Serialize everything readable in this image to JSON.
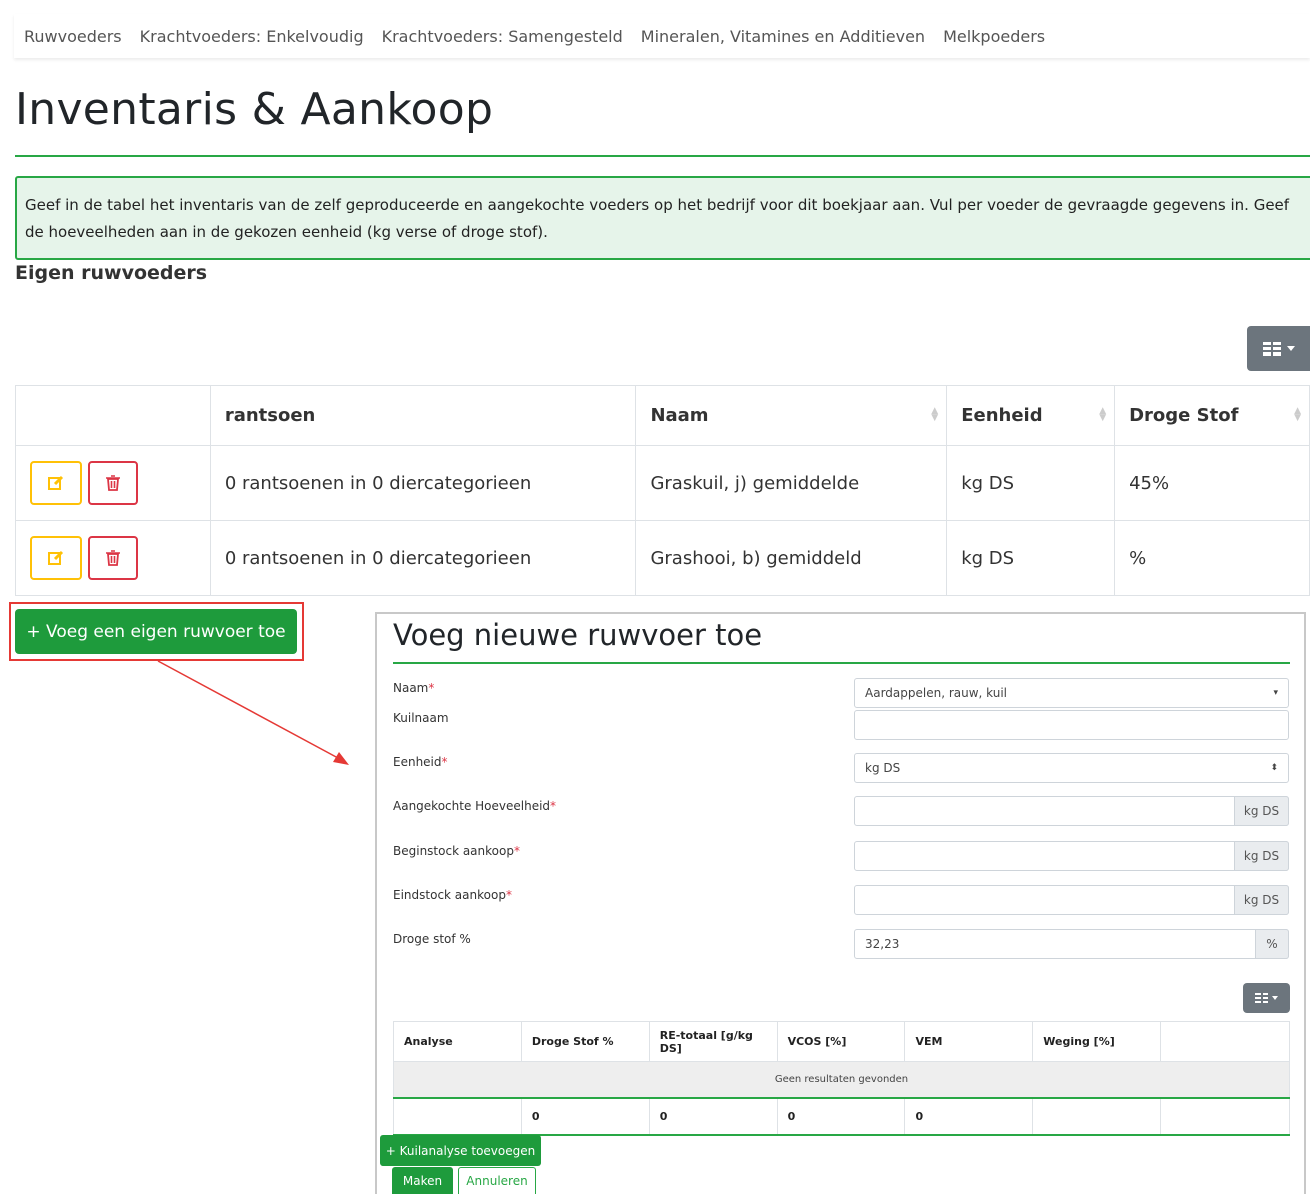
{
  "nav": {
    "items": [
      "Ruwvoeders",
      "Krachtvoeders: Enkelvoudig",
      "Krachtvoeders: Samengesteld",
      "Mineralen, Vitamines en Additieven",
      "Melkpoeders"
    ]
  },
  "page": {
    "title": "Inventaris & Aankoop",
    "intro": "Geef in de tabel het inventaris van de zelf geproduceerde en aangekochte voeders op het bedrijf voor dit boekjaar aan. Vul per voeder de gevraagde gegevens in. Geef de hoeveelheden aan in de gekozen eenheid (kg verse of droge stof).",
    "section_title": "Eigen ruwvoeders",
    "add_button": "+ Voeg een eigen ruwvoer toe"
  },
  "table": {
    "headers": [
      "",
      "rantsoen",
      "Naam",
      "Eenheid",
      "Droge Stof"
    ],
    "rows": [
      {
        "rantsoen": "0 rantsoenen in 0 diercategorieen",
        "naam": "Graskuil, j) gemiddelde",
        "eenheid": "kg DS",
        "droge_stof": "45%"
      },
      {
        "rantsoen": "0 rantsoenen in 0 diercategorieen",
        "naam": "Grashooi, b) gemiddeld",
        "eenheid": "kg DS",
        "droge_stof": "%"
      }
    ]
  },
  "modal": {
    "title": "Voeg nieuwe ruwvoer toe",
    "required_mark": "*",
    "fields": {
      "naam": {
        "label": "Naam",
        "value": "Aardappelen, rauw, kuil"
      },
      "kuilnaam": {
        "label": "Kuilnaam",
        "value": ""
      },
      "eenheid": {
        "label": "Eenheid",
        "value": "kg DS"
      },
      "aangekocht": {
        "label": "Aangekochte Hoeveelheid",
        "value": "",
        "unit": "kg DS"
      },
      "beginstock": {
        "label": "Beginstock aankoop",
        "value": "",
        "unit": "kg DS"
      },
      "eindstock": {
        "label": "Eindstock aankoop",
        "value": "",
        "unit": "kg DS"
      },
      "droge_stof": {
        "label": "Droge stof %",
        "value": "32,23",
        "unit": "%"
      }
    },
    "analysis_table": {
      "headers": [
        "Analyse",
        "Droge Stof %",
        "RE-totaal [g/kg DS]",
        "VCOS [%]",
        "VEM",
        "Weging [%]",
        ""
      ],
      "empty_text": "Geen resultaten gevonden",
      "totals": [
        "",
        "0",
        "0",
        "0",
        "0",
        "",
        ""
      ]
    },
    "kuil_button": "+ Kuilanalyse toevoegen",
    "create_button": "Maken",
    "cancel_button": "Annuleren"
  },
  "colors": {
    "accent_green": "#28a745",
    "button_green": "#1e9b3c",
    "alert_bg": "#e6f4ea",
    "edit_yellow": "#ffc107",
    "delete_red": "#dc3545",
    "annotation_red": "#e53935",
    "secondary_gray": "#6c757d"
  },
  "icons": {
    "edit": "edit-icon",
    "delete": "trash-icon",
    "columns": "grid-icon",
    "sort": "sort-icon"
  }
}
